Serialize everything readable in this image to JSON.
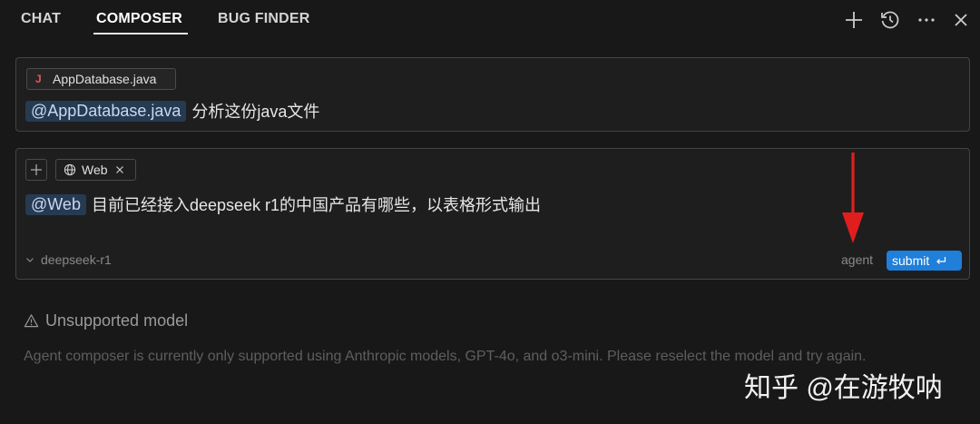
{
  "tabs": [
    {
      "label": "CHAT"
    },
    {
      "label": "COMPOSER",
      "active": true
    },
    {
      "label": "BUG FINDER"
    }
  ],
  "toolbar_icons": [
    "plus-icon",
    "history-icon",
    "more-icon",
    "close-icon"
  ],
  "composer_history": {
    "file_chip": {
      "icon": "J",
      "label": "AppDatabase.java"
    },
    "mention": "@AppDatabase.java",
    "text": "分析这份java文件"
  },
  "composer_input": {
    "context_chip": {
      "label": "Web",
      "icon": "globe-icon"
    },
    "mention": "@Web",
    "text": "目前已经接入deepseek r1的中国产品有哪些，以表格形式输出",
    "model": "deepseek-r1",
    "mode": "agent",
    "submit_label": "submit"
  },
  "warning": {
    "title": "Unsupported model",
    "body": "Agent composer is currently only supported using Anthropic models, GPT-4o, and o3-mini. Please reselect the model and try again."
  },
  "watermark": "知乎 @在游牧呐",
  "colors": {
    "background": "#181818",
    "submit": "#1f7fd9",
    "mention_bg": "#263a52",
    "arrow": "#e01e1e"
  }
}
